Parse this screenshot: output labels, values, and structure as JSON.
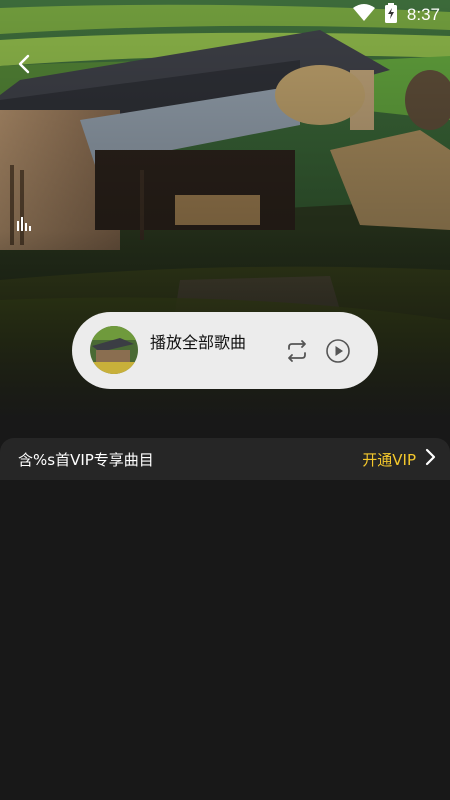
{
  "status_bar": {
    "time": "8:37",
    "icons": [
      "wifi-icon",
      "battery-charging-icon"
    ]
  },
  "header": {
    "back_icon": "chevron-left-icon",
    "equalizer_icon": "equalizer-icon"
  },
  "play_all": {
    "label": "播放全部歌曲",
    "cover_icon": "album-cover",
    "repeat_icon": "repeat-icon",
    "play_icon": "play-circle-icon"
  },
  "vip_banner": {
    "text": "含%s首VIP专享曲目",
    "link_label": "开通VIP",
    "link_icon": "chevron-right-icon"
  },
  "colors": {
    "background": "#181818",
    "vip_bar": "#262626",
    "vip_accent": "#f4c82c",
    "pill": "#ececec"
  }
}
